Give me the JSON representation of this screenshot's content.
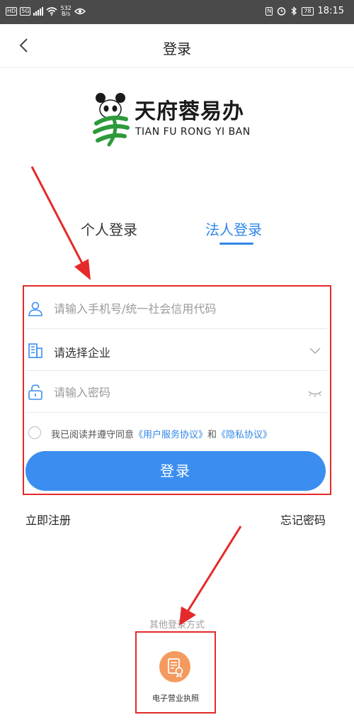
{
  "status_bar": {
    "hd_badge": "HD",
    "network_badge": "5G",
    "net_speed_value": "532",
    "net_speed_unit": "B/s",
    "battery": "78",
    "time": "18:15"
  },
  "header": {
    "title": "登录",
    "back_icon": "chevron-left-icon"
  },
  "logo": {
    "name": "天府蓉易办",
    "subtitle": "TIAN FU RONG YI BAN"
  },
  "tabs": [
    {
      "label": "个人登录",
      "active": false
    },
    {
      "label": "法人登录",
      "active": true
    }
  ],
  "form": {
    "phone_placeholder": "请输入手机号/统一社会信用代码",
    "company_select_value": "请选择企业",
    "password_placeholder": "请输入密码",
    "agree_prefix": "我已阅读并遵守同意",
    "agree_link_user": "《用户服务协议》",
    "agree_conj": "和",
    "agree_link_privacy": "《隐私协议》",
    "login_button": "登录"
  },
  "links": {
    "register": "立即注册",
    "forgot": "忘记密码"
  },
  "other_login": {
    "title": "其他登录方式",
    "license_label": "电子营业执照"
  },
  "colors": {
    "accent": "#3b8ef0",
    "tab_active": "#2f86ea",
    "annotation_red": "#e42a2a",
    "license_orange": "#f59a5f",
    "logo_green": "#2e9a3c"
  }
}
